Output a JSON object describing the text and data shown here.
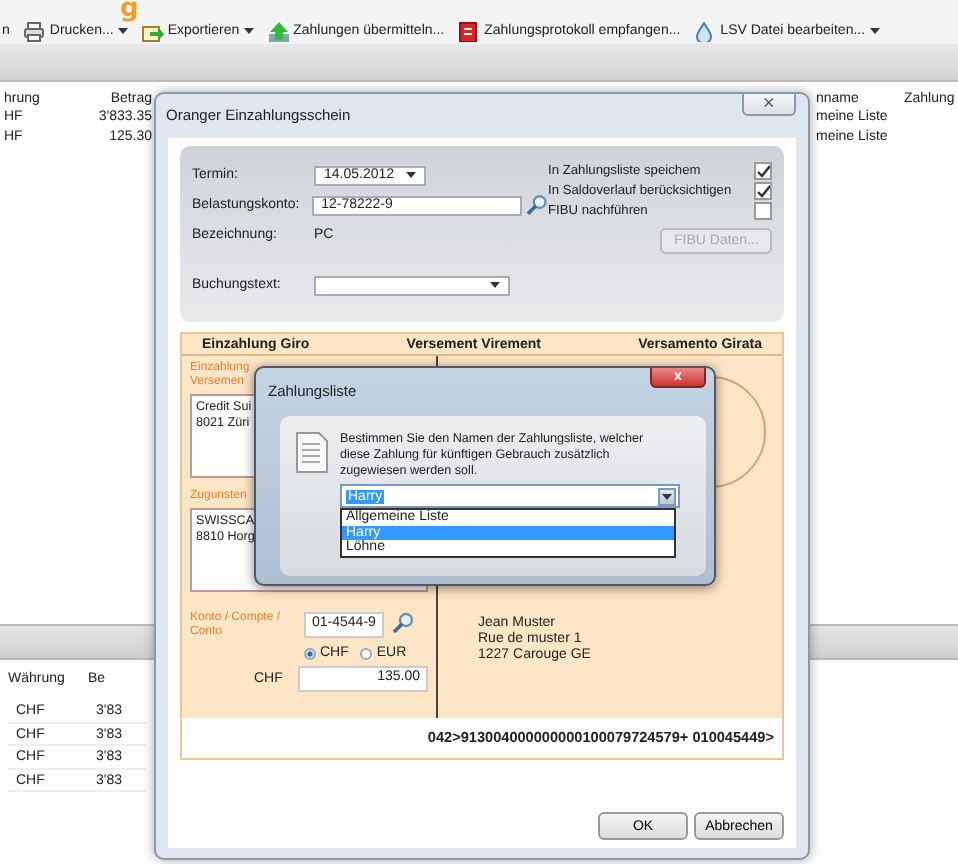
{
  "logo_fragment": "g",
  "toolbar": [
    {
      "label": "n",
      "dropdown": false
    },
    {
      "label": "Drucken...",
      "dropdown": true
    },
    {
      "label": "Exportieren",
      "dropdown": true
    },
    {
      "label": "Zahlungen übermitteln...",
      "dropdown": false
    },
    {
      "label": "Zahlungsprotokoll empfangen...",
      "dropdown": false
    },
    {
      "label": "LSV  Datei bearbeiten...",
      "dropdown": true
    }
  ],
  "upper_table": {
    "columns": [
      "hrung",
      "Betrag",
      "nname",
      "Zahlung"
    ],
    "rows": [
      [
        "HF",
        "3'833.35",
        "meine Liste",
        ""
      ],
      [
        "HF",
        "125.30",
        "meine Liste",
        ""
      ]
    ]
  },
  "lower_table": {
    "columns": [
      "Währung",
      "Be"
    ],
    "rows": [
      [
        "CHF",
        "3'83"
      ],
      [
        "CHF",
        "3'83"
      ],
      [
        "CHF",
        "3'83"
      ],
      [
        "CHF",
        "3'83"
      ]
    ]
  },
  "payment_dialog": {
    "title": "Oranger Einzahlungsschein",
    "close": "⨯",
    "fields": [
      {
        "kind": "date",
        "label": "Termin:",
        "value": "14.05.2012"
      },
      {
        "kind": "account",
        "label": "Belastungskonto:",
        "value": "12-78222-9"
      },
      {
        "kind": "text",
        "label": "Bezeichnung:",
        "value": "PC"
      },
      {
        "kind": "combo",
        "label": "Buchungstext:"
      }
    ],
    "options": [
      {
        "label": "In Zahlungsliste speichem",
        "checked": true
      },
      {
        "label": "In Saldoverlauf berücksichtigen",
        "checked": true
      },
      {
        "label": "FIBU nachführen",
        "checked": false
      }
    ],
    "fibu_button": {
      "label": "FIBU Daten...",
      "disabled": true
    },
    "slip": {
      "headers": [
        "Einzahlung Giro",
        "Versement Virement",
        "Versamento Girata"
      ],
      "payee_label": [
        "Einzahlung",
        "Versemen"
      ],
      "bank_lines": [
        "Credit Sui",
        "8021 Züri"
      ],
      "beneficiary_label": "Zugunsten",
      "beneficiary_lines": [
        "SWISSCA",
        "8810 Horg"
      ],
      "account_label": "Konto / Compte / Conto",
      "account": "01-4544-9",
      "currencies": [
        {
          "label": "CHF",
          "selected": true
        },
        {
          "label": "EUR",
          "selected": false
        }
      ],
      "amount_label": "CHF",
      "amount": "135.00",
      "payer_lines": [
        "Jean Muster",
        "Rue de muster 1",
        "1227 Carouge GE"
      ],
      "code_line": "042>913004000000000100079724579+ 010045449>"
    },
    "buttons": [
      "OK",
      "Abbrechen"
    ]
  },
  "list_dialog": {
    "title": "Zahlungsliste",
    "close": "x",
    "message": "Bestimmen Sie den Namen der Zahlungsliste, welcher diese Zahlung für künftigen Gebrauch zusätzlich zugewiesen werden soll.",
    "value": "Harry",
    "items": [
      {
        "label": "Allgemeine Liste",
        "selected": false
      },
      {
        "label": "Harry",
        "selected": true
      },
      {
        "label": "Löhne",
        "selected": false
      }
    ]
  }
}
